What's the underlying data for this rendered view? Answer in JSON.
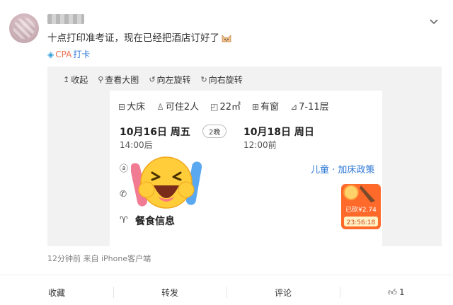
{
  "post": {
    "text": "十点打印准考证，现在已经把酒店订好了",
    "source_tag_prefix": "CPA",
    "source_tag_suffix": "打卡",
    "meta": "12分钟前  来自 iPhone客户端"
  },
  "toolbar": {
    "collapse": "收起",
    "view_large": "查看大图",
    "rotate_left": "向左旋转",
    "rotate_right": "向右旋转"
  },
  "booking": {
    "bed": "大床",
    "guests": "可住2人",
    "area": "22㎡",
    "window": "有窗",
    "floor": "7-11层",
    "checkin_date": "10月16日 周五",
    "checkin_time": "14:00后",
    "nights": "2晚",
    "checkout_date": "10月18日 周日",
    "checkout_time": "12:00前",
    "policy_link": "儿童 · 加床政策",
    "food_heading": "餐食信息"
  },
  "badge": {
    "price_text": "已砍¥2.74",
    "timer": "23:56:18"
  },
  "actions": {
    "favorite": "收藏",
    "repost": "转发",
    "comment": "评论",
    "like_count": "1"
  }
}
